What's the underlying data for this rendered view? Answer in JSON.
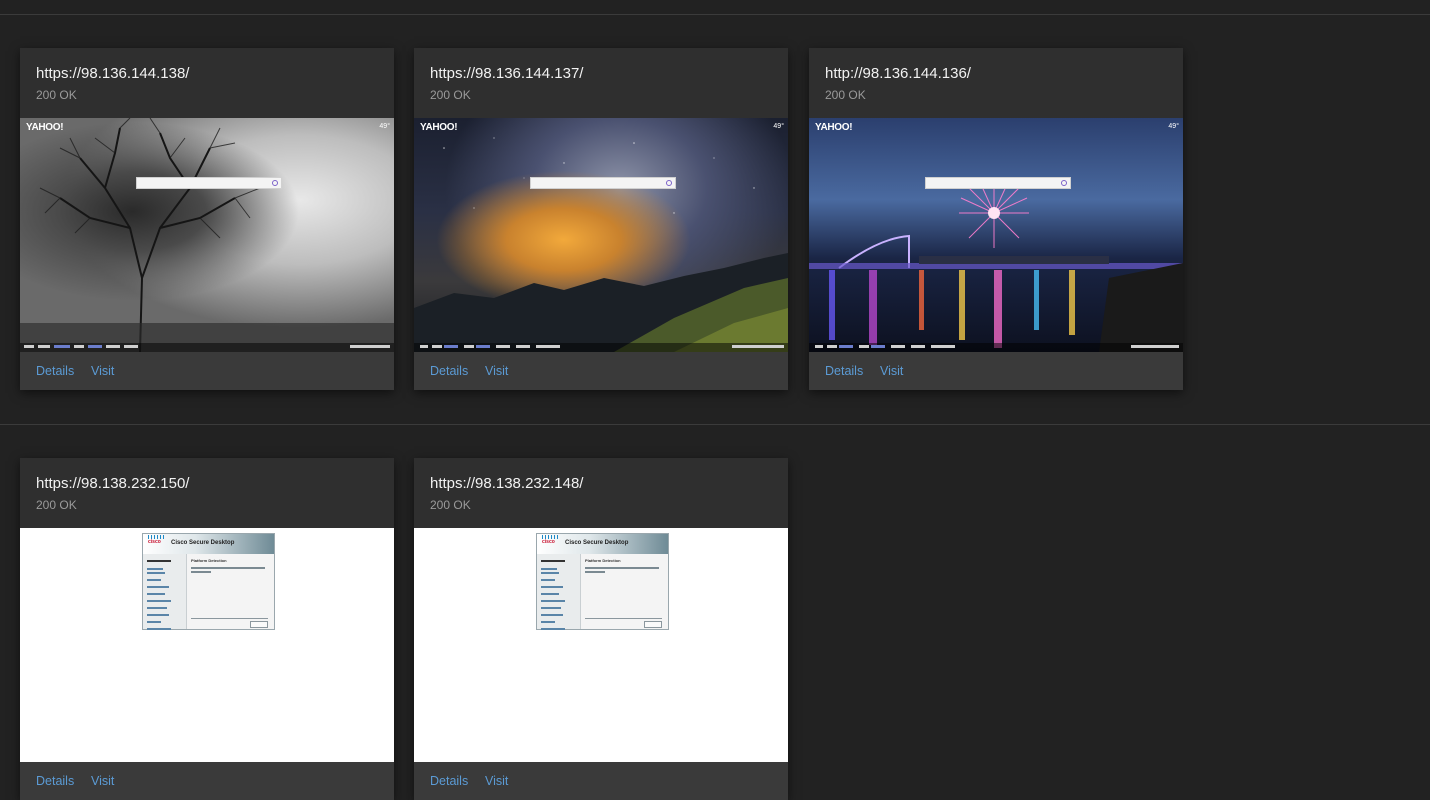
{
  "cards": [
    {
      "url": "https://98.136.144.138/",
      "status": "200 OK",
      "details_label": "Details",
      "visit_label": "Visit",
      "screenshot": {
        "logo": "YAHOO!",
        "weather": "49°"
      }
    },
    {
      "url": "https://98.136.144.137/",
      "status": "200 OK",
      "details_label": "Details",
      "visit_label": "Visit",
      "screenshot": {
        "logo": "YAHOO!",
        "weather": "49°"
      }
    },
    {
      "url": "http://98.136.144.136/",
      "status": "200 OK",
      "details_label": "Details",
      "visit_label": "Visit",
      "screenshot": {
        "logo": "YAHOO!",
        "weather": "49°"
      }
    },
    {
      "url": "https://98.138.232.150/",
      "status": "200 OK",
      "details_label": "Details",
      "visit_label": "Visit",
      "screenshot": {
        "logo": "cisco",
        "title": "Cisco Secure Desktop",
        "heading": "Platform Detection"
      }
    },
    {
      "url": "https://98.138.232.148/",
      "status": "200 OK",
      "details_label": "Details",
      "visit_label": "Visit",
      "screenshot": {
        "logo": "cisco",
        "title": "Cisco Secure Desktop",
        "heading": "Platform Detection"
      }
    }
  ],
  "colors": {
    "background": "#222222",
    "card": "#2f2f2f",
    "footer": "#3a3a3a",
    "link": "#5b9bd5"
  }
}
